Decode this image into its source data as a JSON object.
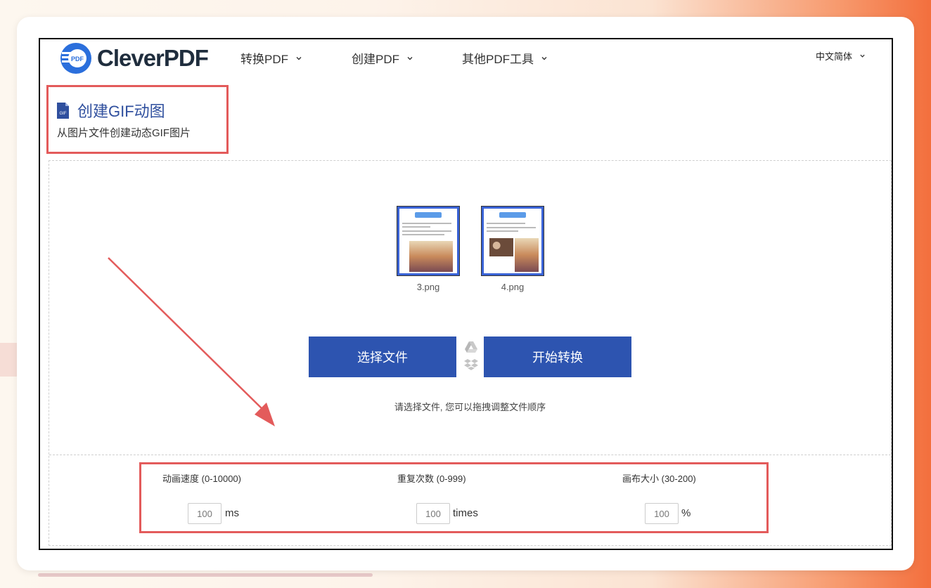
{
  "header": {
    "logo_text": "CleverPDF",
    "logo_badge": "PDF",
    "nav": [
      {
        "label": "转换PDF"
      },
      {
        "label": "创建PDF"
      },
      {
        "label": "其他PDF工具"
      }
    ],
    "language": "中文简体"
  },
  "tool": {
    "title": "创建GIF动图",
    "subtitle": "从图片文件创建动态GIF图片",
    "icon_label": "GIF"
  },
  "files": [
    {
      "name": "3.png"
    },
    {
      "name": "4.png"
    }
  ],
  "actions": {
    "select_label": "选择文件",
    "convert_label": "开始转换",
    "hint": "请选择文件, 您可以拖拽调整文件顺序"
  },
  "options": {
    "speed": {
      "label": "动画速度 (0-10000)",
      "value": "100",
      "unit": "ms"
    },
    "repeat": {
      "label": "重复次数 (0-999)",
      "value": "100",
      "unit": "times"
    },
    "canvas": {
      "label": "画布大小 (30-200)",
      "value": "100",
      "unit": "%"
    }
  },
  "colors": {
    "accent": "#2d54b0",
    "highlight": "#e35b5b",
    "logo_blue": "#2b6fdc"
  },
  "icons": [
    "chevron-down-icon",
    "gif-file-icon",
    "google-drive-icon",
    "dropbox-icon"
  ]
}
